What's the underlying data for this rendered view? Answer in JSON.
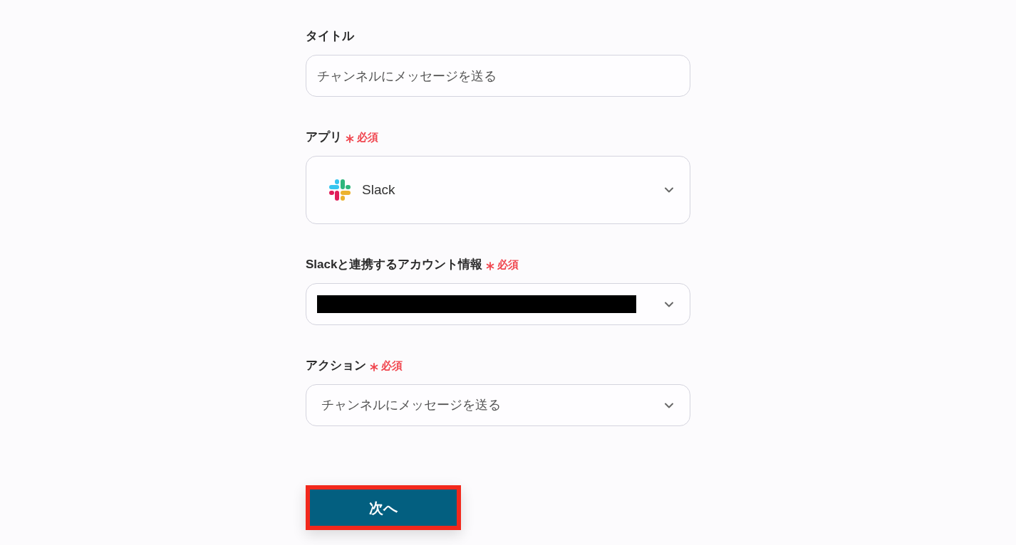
{
  "fields": [
    {
      "kind": "text",
      "label": "タイトル",
      "required": false,
      "value": "チャンネルにメッセージを送る"
    },
    {
      "kind": "app",
      "label": "アプリ",
      "required": true,
      "required_text": "必須",
      "value": "Slack"
    },
    {
      "kind": "select",
      "label": "Slackと連携するアカウント情報",
      "required": true,
      "required_text": "必須",
      "redacted": true
    },
    {
      "kind": "select",
      "label": "アクション",
      "required": true,
      "required_text": "必須",
      "value": "チャンネルにメッセージを送る"
    }
  ],
  "next_button": {
    "label": "次へ",
    "highlighted": true
  }
}
